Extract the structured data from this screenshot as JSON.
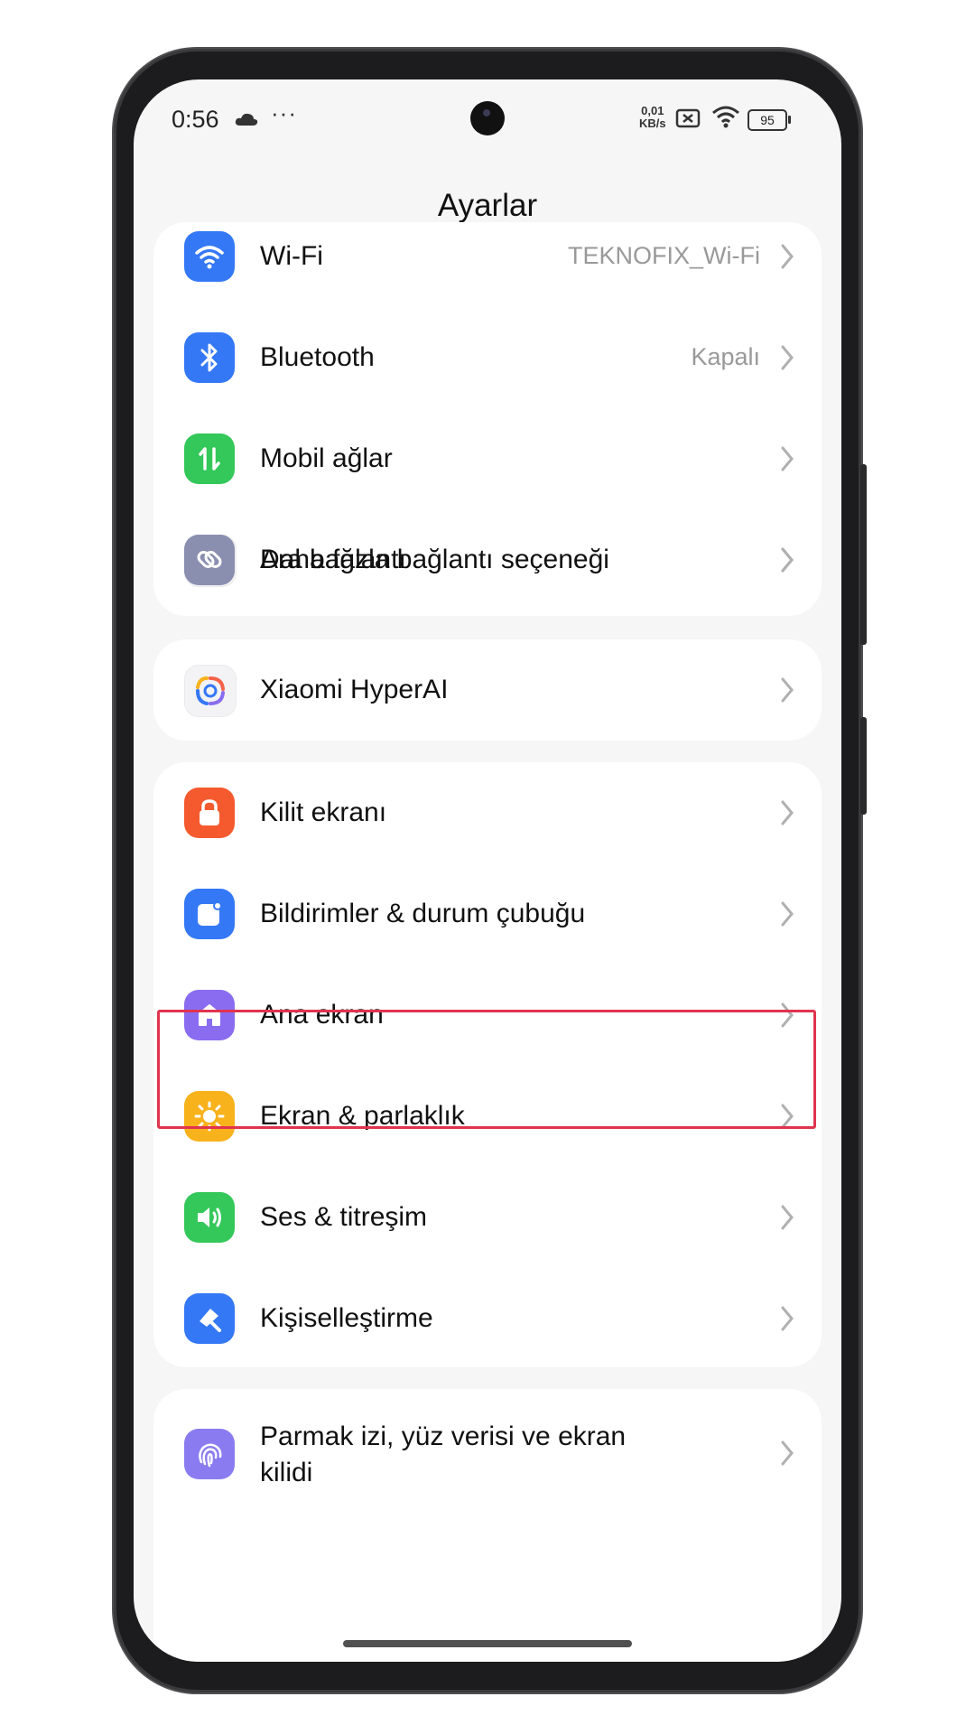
{
  "status_bar": {
    "time": "0:56",
    "net_speed_value": "0,01",
    "net_speed_unit": "KB/s",
    "battery": "95",
    "icons": [
      "cloud-icon",
      "sim-icon",
      "wifi-icon"
    ]
  },
  "header": {
    "title": "Ayarlar"
  },
  "groups": [
    {
      "items": [
        {
          "label": "Wi-Fi",
          "value": "TEKNOFIX_Wi-Fi",
          "icon": "wifi-icon",
          "color": "#3478f6"
        },
        {
          "label": "Bluetooth",
          "value": "Kapalı",
          "icon": "bluetooth-icon",
          "color": "#3478f6"
        },
        {
          "label": "Mobil ağlar",
          "value": "",
          "icon": "mobile-data-icon",
          "color": "#34c759"
        },
        {
          "label": "Ara bağlantı",
          "value": "",
          "icon": "interconnect-icon",
          "color": "#f3f3f5"
        },
        {
          "label": "Daha fazla bağlantı seçeneği",
          "value": "",
          "icon": "link-icon",
          "color": "#8a8fb0"
        }
      ]
    },
    {
      "items": [
        {
          "label": "Xiaomi HyperAI",
          "value": "",
          "icon": "hyperai-icon",
          "color": "#f3f3f5"
        }
      ]
    },
    {
      "items": [
        {
          "label": "Kilit ekranı",
          "value": "",
          "icon": "lock-icon",
          "color": "#f45a2e"
        },
        {
          "label": "Bildirimler & durum çubuğu",
          "value": "",
          "icon": "notification-icon",
          "color": "#3478f6"
        },
        {
          "label": "Ana ekran",
          "value": "",
          "icon": "home-icon",
          "color": "#8a6cf0"
        },
        {
          "label": "Ekran & parlaklık",
          "value": "",
          "icon": "brightness-icon",
          "color": "#f7b21c"
        },
        {
          "label": "Ses & titreşim",
          "value": "",
          "icon": "sound-icon",
          "color": "#34c759"
        },
        {
          "label": "Kişiselleştirme",
          "value": "",
          "icon": "personalization-icon",
          "color": "#3478f6"
        }
      ]
    },
    {
      "items": [
        {
          "label_line1": "Parmak izi, yüz verisi ve ekran",
          "label_line2": "kilidi",
          "value": "",
          "icon": "fingerprint-icon",
          "color": "#8a7cf0"
        }
      ]
    }
  ],
  "highlighted_item": "Bildirimler & durum çubuğu"
}
